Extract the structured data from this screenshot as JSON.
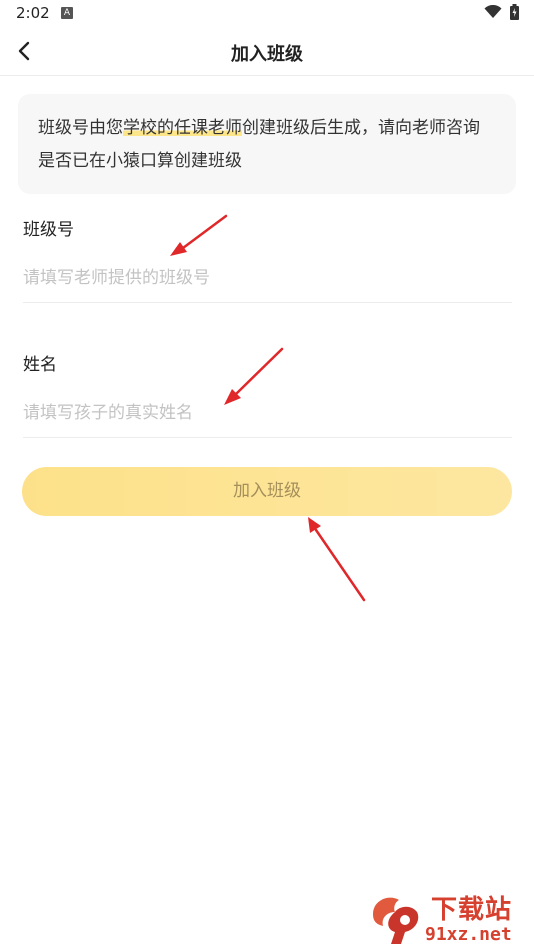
{
  "status_bar": {
    "time": "2:02",
    "notification_icon": "A"
  },
  "header": {
    "title": "加入班级"
  },
  "notice": {
    "part1": "班级号由您",
    "highlight1": "学校的",
    "part2": "",
    "highlight2": "任课老师",
    "part3": "创建班级后生成，请向老师咨询是否已在小猿口算创建班级"
  },
  "form": {
    "class_label": "班级号",
    "class_placeholder": "请填写老师提供的班级号",
    "name_label": "姓名",
    "name_placeholder": "请填写孩子的真实姓名",
    "submit_label": "加入班级"
  },
  "watermark": {
    "brand": "下载站",
    "site": "91xz.net"
  },
  "colors": {
    "button": "#fde18a",
    "button_text": "#a48e5a",
    "arrow": "#e0282a",
    "highlight": "#fde58a"
  }
}
